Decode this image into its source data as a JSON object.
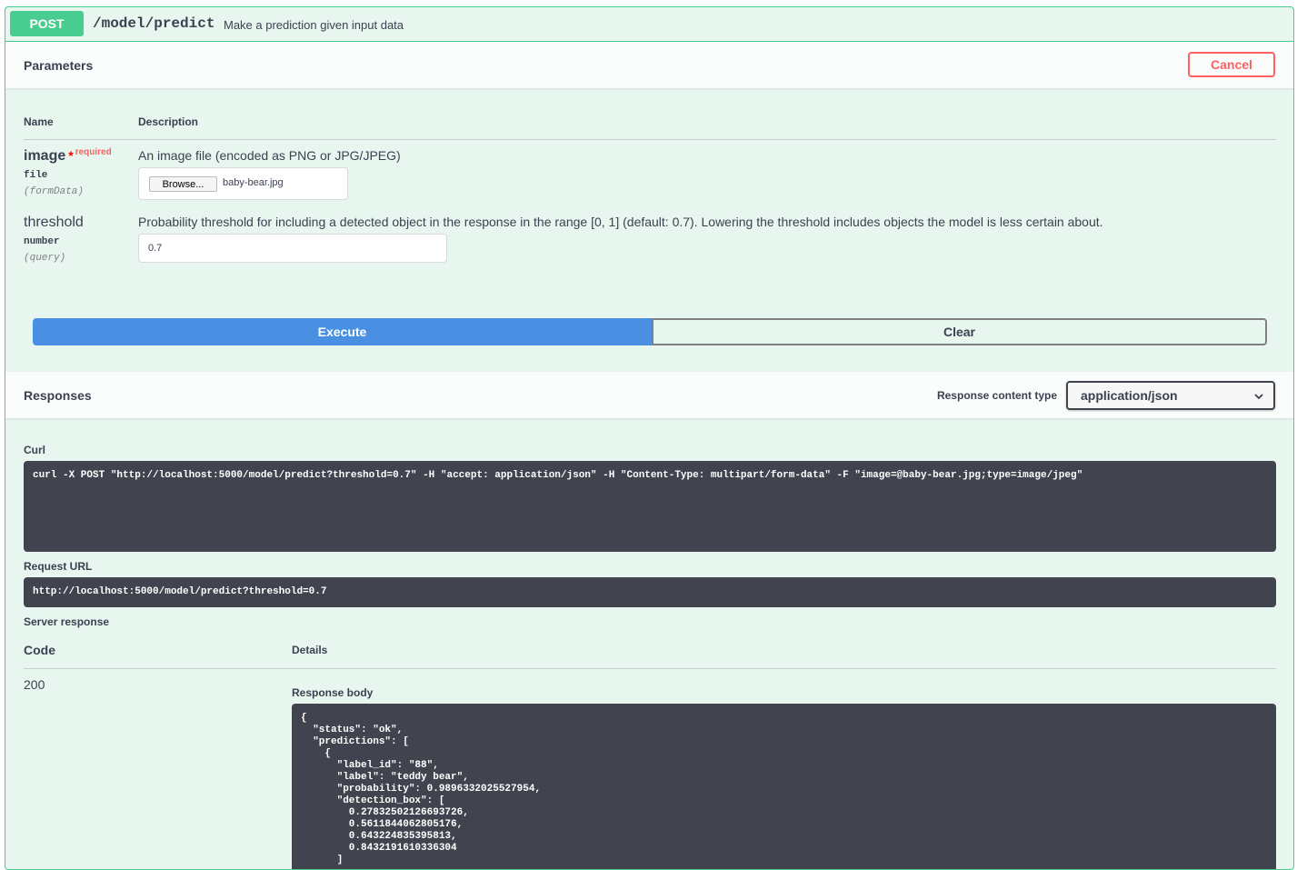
{
  "operation": {
    "method": "POST",
    "path": "/model/predict",
    "summary": "Make a prediction given input data"
  },
  "parameters_section": {
    "title": "Parameters",
    "cancel_label": "Cancel",
    "col_name": "Name",
    "col_description": "Description",
    "params": [
      {
        "name": "image",
        "required_star": "*",
        "required_label": "required",
        "type": "file",
        "in": "(formData)",
        "description": "An image file (encoded as PNG or JPG/JPEG)",
        "browse_label": "Browse...",
        "file_name": "baby-bear.jpg"
      },
      {
        "name": "threshold",
        "type": "number",
        "in": "(query)",
        "description": "Probability threshold for including a detected object in the response in the range [0, 1] (default: 0.7). Lowering the threshold includes objects the model is less certain about.",
        "value": "0.7"
      }
    ]
  },
  "actions": {
    "execute_label": "Execute",
    "clear_label": "Clear"
  },
  "responses_section": {
    "title": "Responses",
    "content_type_label": "Response content type",
    "content_type_value": "application/json",
    "curl_label": "Curl",
    "curl_command": "curl -X POST \"http://localhost:5000/model/predict?threshold=0.7\" -H \"accept: application/json\" -H \"Content-Type: multipart/form-data\" -F \"image=@baby-bear.jpg;type=image/jpeg\"",
    "request_url_label": "Request URL",
    "request_url": "http://localhost:5000/model/predict?threshold=0.7",
    "server_response_label": "Server response",
    "col_code": "Code",
    "col_details": "Details",
    "status_code": "200",
    "response_body_label": "Response body",
    "response_body": "{\n  \"status\": \"ok\",\n  \"predictions\": [\n    {\n      \"label_id\": \"88\",\n      \"label\": \"teddy bear\",\n      \"probability\": 0.9896332025527954,\n      \"detection_box\": [\n        0.27832502126693726,\n        0.5611844062805176,\n        0.643224835395813,\n        0.8432191610336304\n      ]"
  },
  "colors": {
    "post_green": "#49cc90",
    "block_bg": "#e8f6f0",
    "execute_blue": "#4990e2",
    "cancel_red": "#ff6060",
    "code_bg": "#41444e"
  }
}
